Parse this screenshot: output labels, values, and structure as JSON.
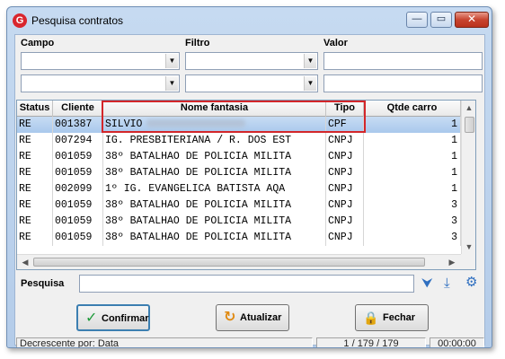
{
  "window": {
    "title": "Pesquisa contratos",
    "min_glyph": "—",
    "max_glyph": "▭",
    "close_glyph": "✕"
  },
  "filters": {
    "campo_label": "Campo",
    "filtro_label": "Filtro",
    "valor_label": "Valor"
  },
  "grid": {
    "columns": [
      "Status",
      "Cliente",
      "Nome fantasia",
      "Tipo",
      "Qtde carro"
    ],
    "rows": [
      {
        "status": "RE",
        "cliente": "001387",
        "nome": "SILVIO",
        "tipo": "CPF",
        "qtde": "1",
        "selected": true
      },
      {
        "status": "RE",
        "cliente": "007294",
        "nome": "IG. PRESBITERIANA / R. DOS EST",
        "tipo": "CNPJ",
        "qtde": "1"
      },
      {
        "status": "RE",
        "cliente": "001059",
        "nome": "38º BATALHAO DE POLICIA MILITA",
        "tipo": "CNPJ",
        "qtde": "1"
      },
      {
        "status": "RE",
        "cliente": "001059",
        "nome": "38º BATALHAO DE POLICIA MILITA",
        "tipo": "CNPJ",
        "qtde": "1"
      },
      {
        "status": "RE",
        "cliente": "002099",
        "nome": " 1º IG. EVANGELICA BATISTA AQA",
        "tipo": "CNPJ",
        "qtde": "1"
      },
      {
        "status": "RE",
        "cliente": "001059",
        "nome": "38º BATALHAO DE POLICIA MILITA",
        "tipo": "CNPJ",
        "qtde": "3"
      },
      {
        "status": "RE",
        "cliente": "001059",
        "nome": "38º BATALHAO DE POLICIA MILITA",
        "tipo": "CNPJ",
        "qtde": "3"
      },
      {
        "status": "RE",
        "cliente": "001059",
        "nome": "38º BATALHAO DE POLICIA MILITA",
        "tipo": "CNPJ",
        "qtde": "3"
      }
    ]
  },
  "search": {
    "label": "Pesquisa",
    "value": ""
  },
  "buttons": {
    "confirm": "Confirmar",
    "refresh": "Atualizar",
    "close": "Fechar"
  },
  "status": {
    "sort": "Decrescente por: Data",
    "position": "1 / 179 / 179",
    "timer": "00:00:00"
  },
  "colors": {
    "selection": "#a9c8ec",
    "highlight_border": "#d3262a",
    "accent": "#2f6fc0"
  }
}
